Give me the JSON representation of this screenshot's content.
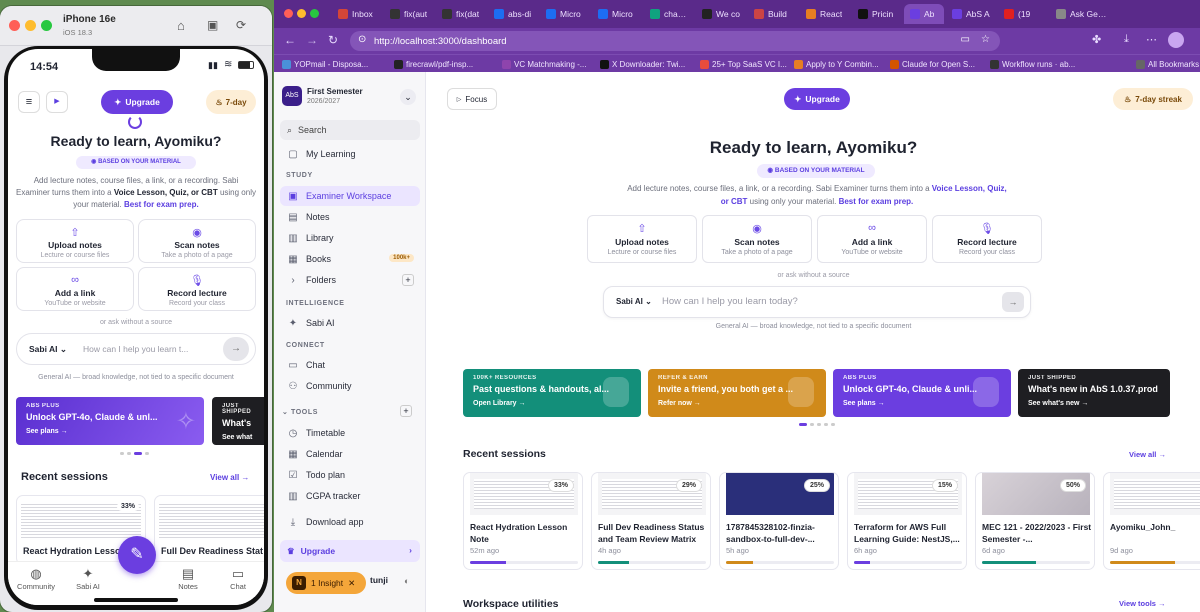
{
  "simulator": {
    "device": "iPhone 16e",
    "os": "iOS 18.3",
    "time": "14:54",
    "upgrade_label": "Upgrade",
    "streak_label": "7-day",
    "heading": "Ready to learn, Ayomiku?",
    "badge": "BASED ON YOUR MATERIAL",
    "desc_prefix": "Add lecture notes, course files, a link, or a recording. Sabi Examiner turns them into a ",
    "desc_highlight": "Voice Lesson, Quiz, or CBT",
    "desc_middle": " using only your material. ",
    "desc_link": "Best for exam prep.",
    "cards": [
      {
        "icon": "upload-icon",
        "glyph": "⇧",
        "title": "Upload notes",
        "sub": "Lecture or course files"
      },
      {
        "icon": "camera-icon",
        "glyph": "◉",
        "title": "Scan notes",
        "sub": "Take a photo of a page"
      },
      {
        "icon": "link-icon",
        "glyph": "∞",
        "title": "Add a link",
        "sub": "YouTube or website"
      },
      {
        "icon": "mic-icon",
        "glyph": "🎙",
        "title": "Record lecture",
        "sub": "Record your class"
      }
    ],
    "or_ask": "or ask without a source",
    "model": "Sabi AI",
    "placeholder": "How can I help you learn t...",
    "ai_note": "General AI — broad knowledge, not tied to a specific document",
    "promo": {
      "kicker": "ABS PLUS",
      "title": "Unlock GPT-4o, Claude & unl...",
      "link": "See plans →"
    },
    "promo2": {
      "kicker": "JUST SHIPPED",
      "title": "What's",
      "link": "See what"
    },
    "recent_title": "Recent sessions",
    "view_all": "View all →",
    "sessions": [
      {
        "title": "React Hydration Lesson",
        "pct": "33%"
      },
      {
        "title": "Full Dev Readiness Stat",
        "pct": ""
      }
    ],
    "tabs": [
      "Community",
      "Sabi AI",
      "",
      "Notes",
      "Chat"
    ]
  },
  "browser": {
    "tabs": [
      "Inbox",
      "fix(aut",
      "fix(dat",
      "abs-di",
      "Micro",
      "Micro",
      "chatgp",
      "We co",
      "Build",
      "React",
      "Pricin",
      "Ab",
      "AbS A",
      "(19",
      "Ask Gemini"
    ],
    "url": "http://localhost:3000/dashboard",
    "bookmarks": [
      "YOPmail - Disposa...",
      "firecrawl/pdf-insp...",
      "VC Matchmaking -...",
      "X Downloader: Twi...",
      "25+ Top SaaS VC I...",
      "Apply to Y Combin...",
      "Claude for Open S...",
      "Workflow runs · ab...",
      "All Bookmarks"
    ]
  },
  "sidebar": {
    "semester": "First Semester",
    "year": "2026/2027",
    "search": "Search",
    "my_learning": "My Learning",
    "sec_study": "STUDY",
    "study": [
      "Examiner Workspace",
      "Notes",
      "Library",
      "Books",
      "Folders"
    ],
    "books_badge": "100k+",
    "sec_intel": "INTELLIGENCE",
    "sabi": "Sabi AI",
    "sec_connect": "CONNECT",
    "connect": [
      "Chat",
      "Community"
    ],
    "sec_tools": "TOOLS",
    "tools": [
      "Timetable",
      "Calendar",
      "Todo plan",
      "CGPA tracker"
    ],
    "download": "Download app",
    "upgrade": "Upgrade",
    "insight": "1 Insight",
    "user_partial": "tunji"
  },
  "main": {
    "focus": "Focus",
    "upgrade": "Upgrade",
    "streak": "7-day streak",
    "heading": "Ready to learn, Ayomiku?",
    "badge": "BASED ON YOUR MATERIAL",
    "desc_prefix": "Add lecture notes, course files, a link, or a recording. Sabi Examiner turns them into a ",
    "desc_highlight": "Voice Lesson, Quiz, or CBT",
    "desc_middle": " using only your material. ",
    "desc_link": "Best for exam prep.",
    "cards": [
      {
        "icon": "upload-icon",
        "glyph": "⇧",
        "title": "Upload notes",
        "sub": "Lecture or course files"
      },
      {
        "icon": "camera-icon",
        "glyph": "◉",
        "title": "Scan notes",
        "sub": "Take a photo of a page"
      },
      {
        "icon": "link-icon",
        "glyph": "∞",
        "title": "Add a link",
        "sub": "YouTube or website"
      },
      {
        "icon": "mic-icon",
        "glyph": "🎙",
        "title": "Record lecture",
        "sub": "Record your class"
      }
    ],
    "or_ask": "or ask without a source",
    "model": "Sabi AI",
    "placeholder": "How can I help you learn today?",
    "ai_note": "General AI — broad knowledge, not tied to a specific document",
    "promos": [
      {
        "kicker": "100K+ RESOURCES",
        "title": "Past questions & handouts, al...",
        "link": "Open Library →",
        "color": "#138f7a"
      },
      {
        "kicker": "REFER & EARN",
        "title": "Invite a friend, you both get a ...",
        "link": "Refer now →",
        "color": "#d08a1a"
      },
      {
        "kicker": "ABS PLUS",
        "title": "Unlock GPT-4o, Claude & unli...",
        "link": "See plans →",
        "color": "#6b3ee0"
      },
      {
        "kicker": "JUST SHIPPED",
        "title": "What's new in AbS 1.0.37.prod",
        "link": "See what's new →",
        "color": "#1e1e22"
      }
    ],
    "recent_title": "Recent sessions",
    "view_all": "View all →",
    "sessions": [
      {
        "title": "React Hydration Lesson Note",
        "ago": "52m ago",
        "pct": "33%",
        "progress": 0.33,
        "bar": "#6b3ee0",
        "thumb": "doc"
      },
      {
        "title": "Full Dev Readiness Status and Team Review Matrix",
        "ago": "4h ago",
        "pct": "29%",
        "progress": 0.29,
        "bar": "#138f7a",
        "thumb": "doc"
      },
      {
        "title": "1787845328102-finzia-sandbox-to-full-dev-...",
        "ago": "5h ago",
        "pct": "25%",
        "progress": 0.25,
        "bar": "#d08a1a",
        "thumb": "dark"
      },
      {
        "title": "Terraform for AWS Full Learning Guide: NestJS,...",
        "ago": "6h ago",
        "pct": "15%",
        "progress": 0.15,
        "bar": "#6b3ee0",
        "thumb": "doc"
      },
      {
        "title": "MEC 121 - 2022/2023 - First Semester -...",
        "ago": "6d ago",
        "pct": "50%",
        "progress": 0.5,
        "bar": "#138f7a",
        "thumb": "photo"
      },
      {
        "title": "Ayomiku_John_",
        "ago": "9d ago",
        "pct": "",
        "progress": 0.6,
        "bar": "#d08a1a",
        "thumb": "doc"
      }
    ],
    "utilities_title": "Workspace utilities",
    "view_tools": "View tools →"
  }
}
